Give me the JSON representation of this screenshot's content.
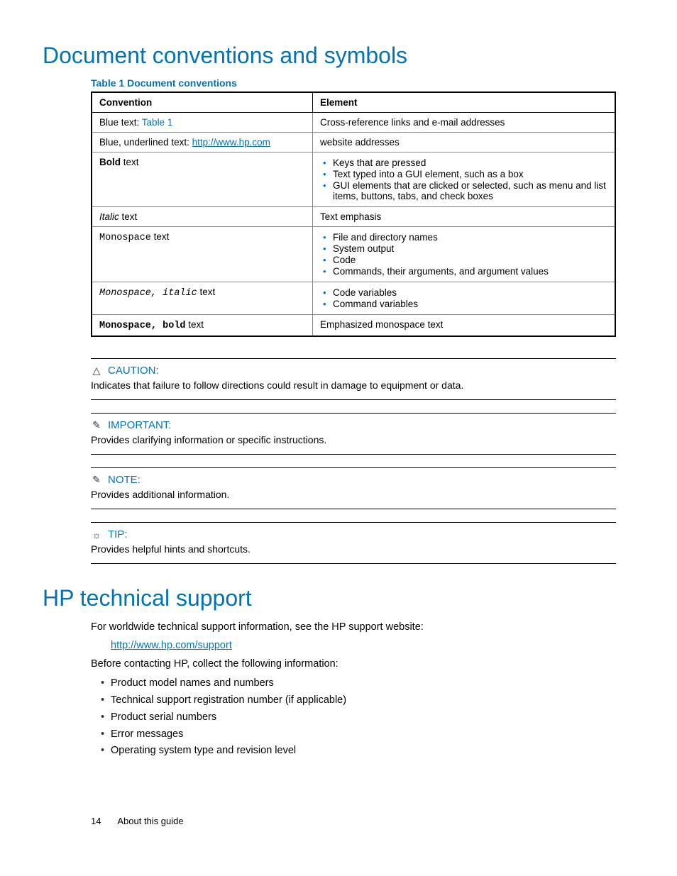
{
  "heading1": "Document conventions and symbols",
  "tableCaption": "Table 1 Document conventions",
  "th1": "Convention",
  "th2": "Element",
  "row1": {
    "prefix": "Blue text: ",
    "link": "Table 1",
    "element": "Cross-reference links and e-mail addresses"
  },
  "row2": {
    "prefix": "Blue, underlined text: ",
    "link": "http://www.hp.com",
    "element": "website addresses"
  },
  "row3": {
    "bold": "Bold",
    "suffix": " text",
    "items": [
      "Keys that are pressed",
      "Text typed into a GUI element, such as a box",
      "GUI elements that are clicked or selected, such as menu and list items, buttons, tabs, and check boxes"
    ]
  },
  "row4": {
    "italic": "Italic",
    "suffix": " text",
    "element": "Text emphasis"
  },
  "row5": {
    "mono": "Monospace",
    "suffix": " text",
    "items": [
      "File and directory names",
      "System output",
      "Code",
      "Commands, their arguments, and argument values"
    ]
  },
  "row6": {
    "mono": "Monospace, italic",
    "suffix": " text",
    "items": [
      "Code variables",
      "Command variables"
    ]
  },
  "row7": {
    "mono": "Monospace, bold",
    "suffix": " text",
    "element": "Emphasized monospace text"
  },
  "callouts": [
    {
      "icon": "△",
      "title": "CAUTION:",
      "body": "Indicates that failure to follow directions could result in damage to equipment or data."
    },
    {
      "icon": "✎",
      "title": "IMPORTANT:",
      "body": "Provides clarifying information or specific instructions."
    },
    {
      "icon": "✎",
      "title": "NOTE:",
      "body": "Provides additional information."
    },
    {
      "icon": "☼",
      "title": "TIP:",
      "body": "Provides helpful hints and shortcuts."
    }
  ],
  "heading2": "HP technical support",
  "support": {
    "p1": "For worldwide technical support information, see the HP support website:",
    "link": "http://www.hp.com/support",
    "p2": "Before contacting HP, collect the following information:",
    "items": [
      "Product model names and numbers",
      "Technical support registration number (if applicable)",
      "Product serial numbers",
      "Error messages",
      "Operating system type and revision level"
    ]
  },
  "footer": {
    "page": "14",
    "section": "About this guide"
  }
}
